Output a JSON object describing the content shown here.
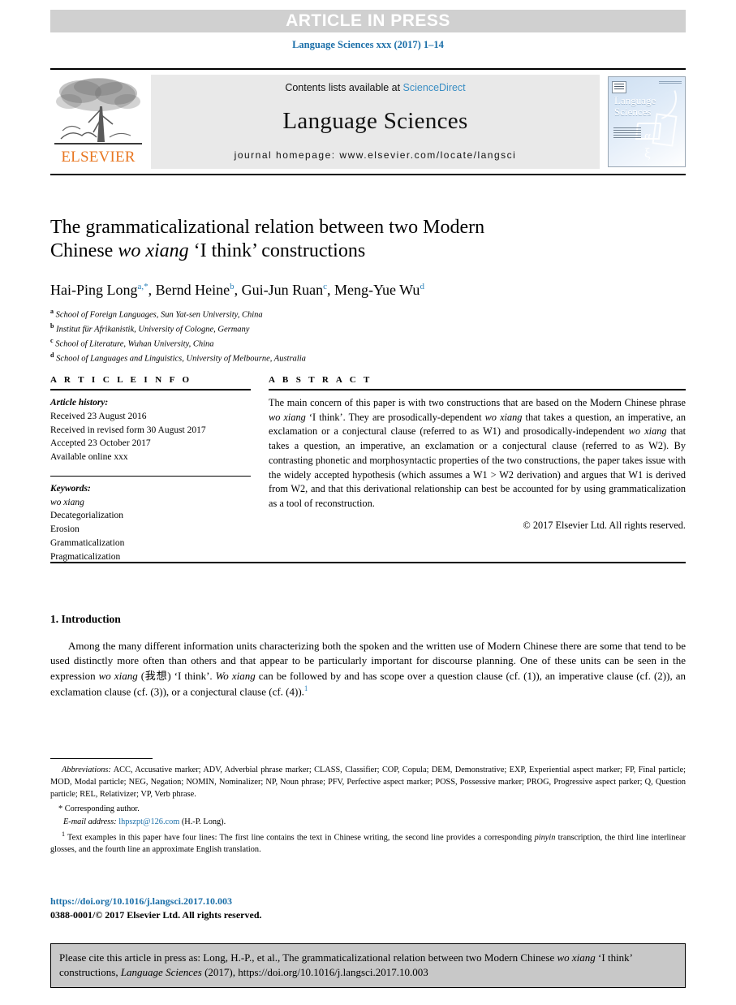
{
  "banner": {
    "article_in_press": "ARTICLE IN PRESS",
    "banner_bg": "#d0d0d0",
    "banner_text_color": "#ffffff"
  },
  "journal_ref": "Language Sciences xxx (2017) 1–14",
  "masthead": {
    "publisher_logo_label": "ELSEVIER",
    "contents_prefix": "Contents lists available at ",
    "contents_link": "ScienceDirect",
    "journal_name": "Language Sciences",
    "homepage": "journal homepage: www.elsevier.com/locate/langsci",
    "cover": {
      "line1": "Language",
      "line2": "Sciences",
      "alpha_glyph": "α",
      "xi_glyph": "ξ"
    },
    "link_color": "#3a8ec4",
    "logo_color": "#e87722"
  },
  "title": {
    "line1_pre": "The grammaticalizational relation between two Modern",
    "line2_pre": "Chinese ",
    "line2_italic": "wo xiang",
    "line2_post": " ‘I think’ constructions"
  },
  "authors": {
    "list": [
      {
        "name": "Hai-Ping Long",
        "marks": "a,*"
      },
      {
        "name": "Bernd Heine",
        "marks": "b"
      },
      {
        "name": "Gui-Jun Ruan",
        "marks": "c"
      },
      {
        "name": "Meng-Yue Wu",
        "marks": "d"
      }
    ],
    "mark_color": "#2980b9"
  },
  "affiliations": [
    {
      "mark": "a",
      "text": "School of Foreign Languages, Sun Yat-sen University, China"
    },
    {
      "mark": "b",
      "text": "Institut für Afrikanistik, University of Cologne, Germany"
    },
    {
      "mark": "c",
      "text": "School of Literature, Wuhan University, China"
    },
    {
      "mark": "d",
      "text": "School of Languages and Linguistics, University of Melbourne, Australia"
    }
  ],
  "article_info": {
    "heading": "A R T I C L E   I N F O",
    "history_label": "Article history:",
    "history": [
      "Received 23 August 2016",
      "Received in revised form 30 August 2017",
      "Accepted 23 October 2017",
      "Available online xxx"
    ],
    "keywords_label": "Keywords:",
    "keywords": [
      "wo xiang",
      "Decategorialization",
      "Erosion",
      "Grammaticalization",
      "Pragmaticalization"
    ],
    "keyword_italic_index": 0
  },
  "abstract": {
    "heading": "A B S T R A C T",
    "p1": "The main concern of this paper is with two constructions that are based on the Modern Chinese phrase ",
    "i1": "wo xiang",
    "p2": " ‘I think’. They are prosodically-dependent ",
    "i2": "wo xiang",
    "p3": " that takes a question, an imperative, an exclamation or a conjectural clause (referred to as W1) and prosodically-independent ",
    "i3": "wo xiang",
    "p4": " that takes a question, an imperative, an exclamation or a conjectural clause (referred to as W2). By contrasting phonetic and morphosyntactic properties of the two constructions, the paper takes issue with the widely accepted hypothesis (which assumes a W1 > W2 derivation) and argues that W1 is derived from W2, and that this derivational relationship can best be accounted for by using grammaticalization as a tool of reconstruction.",
    "copyright": "© 2017 Elsevier Ltd. All rights reserved."
  },
  "introduction": {
    "heading": "1. Introduction",
    "p1": "Among the many different information units characterizing both the spoken and the written use of Modern Chinese there are some that tend to be used distinctly more often than others and that appear to be particularly important for discourse planning. One of these units can be seen in the expression ",
    "i1": "wo xiang",
    "p2": " (我想) ‘I think’. ",
    "i2": "Wo xiang",
    "p3": " can be followed by and has scope over a question clause (cf. (1)), an imperative clause (cf. (2)), an exclamation clause (cf. (3)), or a conjectural clause (cf. (4)).",
    "footnote_marker": "1"
  },
  "footnotes": {
    "abbrev_label": "Abbreviations:",
    "abbrev_text": " ACC, Accusative marker; ADV, Adverbial phrase marker; CLASS, Classifier; COP, Copula; DEM, Demonstrative; EXP, Experiential aspect marker; FP, Final particle; MOD, Modal particle; NEG, Negation; NOMIN, Nominalizer; NP, Noun phrase; PFV, Perfective aspect marker; POSS, Possessive marker; PROG, Progressive aspect parker; Q, Question particle; REL, Relativizer; VP, Verb phrase.",
    "corresponding": "* Corresponding author.",
    "email_label": "E-mail address:",
    "email": "lhpszpt@126.com",
    "email_suffix": " (H.-P. Long).",
    "note1_marker": "1",
    "note1_a": " Text examples in this paper have four lines: The first line contains the text in Chinese writing, the second line provides a corresponding ",
    "note1_i": "pinyin",
    "note1_b": " transcription, the third line interlinear glosses, and the fourth line an approximate English translation.",
    "link_color": "#1a6ea8"
  },
  "doi": {
    "url": "https://doi.org/10.1016/j.langsci.2017.10.003",
    "issn_line": "0388-0001/© 2017 Elsevier Ltd. All rights reserved."
  },
  "cite_box": {
    "pre": "Please cite this article in press as: Long, H.-P., et al., The grammaticalizational relation between two Modern Chinese ",
    "i1": "wo xiang",
    "mid": " ‘I think’ constructions, ",
    "i2": "Language Sciences",
    "post": " (2017), https://doi.org/10.1016/j.langsci.2017.10.003",
    "bg": "#c8c8c8"
  }
}
